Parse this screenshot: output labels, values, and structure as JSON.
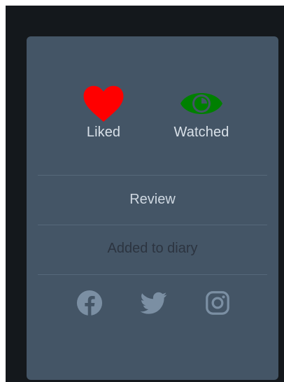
{
  "actions": {
    "liked": {
      "label": "Liked",
      "icon": "heart-icon",
      "color": "#ff0000"
    },
    "watched": {
      "label": "Watched",
      "icon": "eye-icon",
      "color": "#008000"
    }
  },
  "review_label": "Review",
  "diary_label": "Added to diary",
  "share": {
    "icons": [
      "facebook-icon",
      "twitter-icon",
      "instagram-icon"
    ],
    "color": "#7b8fa3"
  },
  "colors": {
    "page_background": "#14181c",
    "card_background": "#445566",
    "divider": "#56687a"
  }
}
